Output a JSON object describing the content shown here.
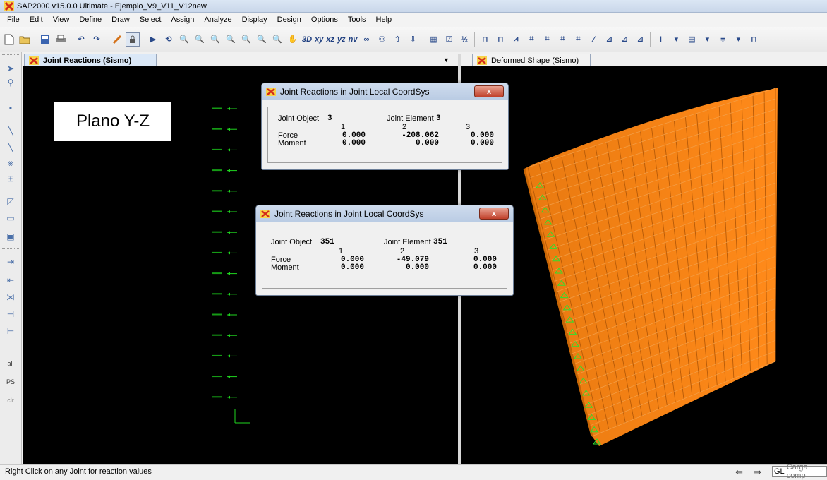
{
  "window": {
    "title": "SAP2000 v15.0.0 Ultimate  - Ejemplo_V9_V11_V12new"
  },
  "menu": [
    "File",
    "Edit",
    "View",
    "Define",
    "Draw",
    "Select",
    "Assign",
    "Analyze",
    "Display",
    "Design",
    "Options",
    "Tools",
    "Help"
  ],
  "toolbar": {
    "xy": "xy",
    "xz": "xz",
    "yz": "yz",
    "nv": "nv",
    "three_d": "3D"
  },
  "lefttools": {
    "all": "all",
    "ps": "PS",
    "clr": "clr"
  },
  "tabs": {
    "left": "Joint Reactions  (Sismo)",
    "right": "Deformed Shape (Sismo)"
  },
  "annotation": {
    "plane": "Plano Y-Z"
  },
  "dialogs": [
    {
      "title": "Joint Reactions in Joint Local CoordSys",
      "close": "x",
      "object_label": "Joint Object",
      "object_id": "3",
      "element_label": "Joint Element",
      "element_id": "3",
      "cols": [
        "1",
        "2",
        "3"
      ],
      "force_label": "Force",
      "force": [
        "0.000",
        "-208.062",
        "0.000"
      ],
      "moment_label": "Moment",
      "moment": [
        "0.000",
        "0.000",
        "0.000"
      ]
    },
    {
      "title": "Joint Reactions in Joint Local CoordSys",
      "close": "x",
      "object_label": "Joint Object",
      "object_id": "351",
      "element_label": "Joint Element",
      "element_id": "351",
      "cols": [
        "1",
        "2",
        "3"
      ],
      "force_label": "Force",
      "force": [
        "0.000",
        "-49.079",
        "0.000"
      ],
      "moment_label": "Moment",
      "moment": [
        "0.000",
        "0.000",
        "0.000"
      ]
    }
  ],
  "status": {
    "message": "Right Click on any Joint for reaction values",
    "coord": "GL",
    "units": "Carga comp"
  },
  "colors": {
    "mesh": "#ff8000",
    "reaction": "#1fd61f",
    "background": "#000000"
  }
}
